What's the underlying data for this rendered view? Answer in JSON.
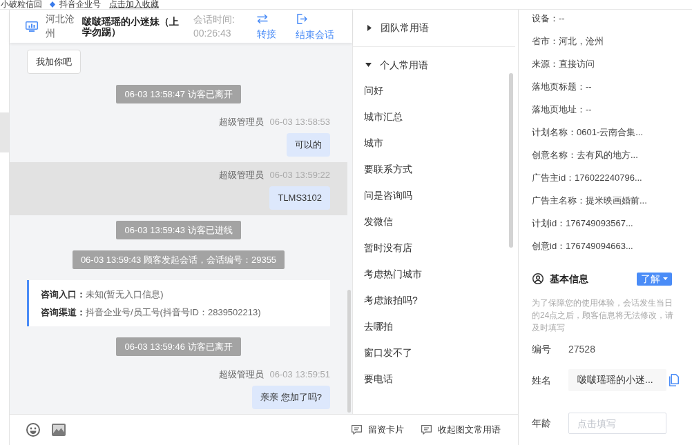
{
  "top_strip": {
    "site_name": "小破粒信回",
    "account": "抖音企业号",
    "bookmark_link": "点击加入收藏"
  },
  "chat_header": {
    "location": "河北沧州",
    "visitor_name": "啵啵瑶瑶的小迷妹（上学勿踢）",
    "duration_label": "会话时间:",
    "duration": "00:26:43",
    "actions": [
      {
        "kind": "transfer",
        "label": "转接"
      },
      {
        "kind": "end",
        "label": "结束会话"
      }
    ]
  },
  "messages": [
    {
      "kind": "visitor",
      "text": "我加你吧",
      "highlighted": false
    },
    {
      "kind": "system",
      "text": "06-03 13:58:47 访客已离开",
      "highlighted": false
    },
    {
      "kind": "agent",
      "sender": "超级管理员",
      "time": "06-03 13:58:53",
      "text": "可以的",
      "highlighted": false
    },
    {
      "kind": "agent",
      "sender": "超级管理员",
      "time": "06-03 13:59:22",
      "text": "TLMS3102",
      "highlighted": true
    },
    {
      "kind": "system",
      "text": "06-03 13:59:43 访客已进线",
      "highlighted": false
    },
    {
      "kind": "system",
      "text": "06-03 13:59:43 顾客发起会话，会话编号：29355",
      "highlighted": false
    },
    {
      "kind": "info",
      "fields": [
        {
          "label": "咨询入口：",
          "value": "未知(暂无入口信息)"
        },
        {
          "label": "咨询渠道：",
          "value": "抖音企业号/员工号(抖音号ID：2839502213)"
        }
      ],
      "highlighted": false
    },
    {
      "kind": "system",
      "text": "06-03 13:59:46 访客已离开",
      "highlighted": false
    },
    {
      "kind": "agent",
      "sender": "超级管理员",
      "time": "06-03 13:59:51",
      "text": "亲亲 您加了吗?",
      "highlighted": false
    }
  ],
  "phrase_groups": [
    {
      "title": "团队常用语",
      "expanded": false
    },
    {
      "title": "个人常用语",
      "expanded": true,
      "items": [
        "问好",
        "城市汇总",
        "城市",
        "要联系方式",
        "问是咨询吗",
        "发微信",
        "暂时没有店",
        "考虑热门城市",
        "考虑旅拍吗?",
        "去哪拍",
        "窗口发不了",
        "要电话"
      ]
    }
  ],
  "bottom_actions": [
    {
      "label": "留资卡片"
    },
    {
      "label": "收起图文常用语"
    }
  ],
  "visitor_details": [
    "设备：--",
    "省市：河北，沧州",
    "来源：直接访问",
    "落地页标题：--",
    "落地页地址：--",
    "计划名称：0601-云南合集...",
    "创意名称：去有风的地方...",
    "广告主id：176022240796...",
    "广告主名称：提米映画婚前...",
    "计划id：176749093567...",
    "创意id：176749094663..."
  ],
  "basic_info": {
    "title": "基本信息",
    "tag": "了解",
    "notice": "为了保障您的使用体验，会话发生当日的24点之后，顾客信息将无法修改，请及时填写",
    "fields": [
      {
        "kind": "text",
        "label": "编号",
        "value": "27528"
      },
      {
        "kind": "filled",
        "label": "姓名",
        "value": "啵啵瑶瑶的小迷..."
      },
      {
        "kind": "input",
        "label": "年龄",
        "placeholder": "点击填写"
      }
    ]
  }
}
